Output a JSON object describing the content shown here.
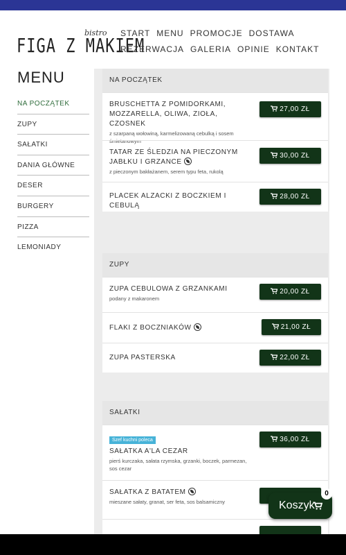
{
  "brand": {
    "name": "FIGA Z MAKIEM",
    "sub": "bistro"
  },
  "nav": [
    "START",
    "MENU",
    "PROMOCJE",
    "DOSTAWA",
    "REZERWACJA",
    "GALERIA",
    "OPINIE",
    "KONTAKT"
  ],
  "sidebar": {
    "title": "MENU",
    "items": [
      "NA POCZĄTEK",
      "ZUPY",
      "SAŁATKI",
      "DANIA GŁÓWNE",
      "DESER",
      "BURGERY",
      "PIZZA",
      "LEMONIADY"
    ]
  },
  "sections": [
    {
      "title": "NA POCZĄTEK",
      "items": [
        {
          "name": "BRUSCHETTA Z POMIDORKAMI, MOZZARELLA, OLIWA, ZIOŁA, CZOSNEK",
          "desc": "z szarpaną wołowiną, karmelizowaną cebulką i sosem śmietanowym",
          "price": "27,00 ZŁ"
        },
        {
          "name": "TATAR ZE ŚLEDZIA NA PIECZONYM JABŁKU I GRZANCE",
          "desc": "z pieczonym bakłażanem, serem typu feta, rukolą",
          "price": "30,00 ZŁ"
        },
        {
          "name": "PLACEK ALZACKI Z BOCZKIEM I CEBULĄ",
          "desc": "",
          "price": "28,00 ZŁ"
        }
      ]
    },
    {
      "title": "ZUPY",
      "items": [
        {
          "name": "ZUPA CEBULOWA Z GRZANKAMI",
          "desc": "podany z makaronem",
          "price": "20,00 ZŁ"
        },
        {
          "name": "FLAKI Z BOCZNIAKÓW",
          "desc": "",
          "price": "21,00 ZŁ"
        },
        {
          "name": "ZUPA PASTERSKA",
          "desc": "",
          "price": "22,00 ZŁ"
        }
      ]
    },
    {
      "title": "SAŁATKI",
      "items": [
        {
          "badge": "Szef kuchni poleca",
          "name": "SAŁATKA A'LA CEZAR",
          "desc": "pierś kurczaka, sałata rzymska, grzanki, boczek, parmezan, sos cezar",
          "price": "36,00 ZŁ"
        },
        {
          "name": "SAŁATKA Z BATATEM",
          "desc": "mieszane sałaty, granat, ser feta, sos balsamiczny",
          "price": ""
        }
      ]
    }
  ],
  "cart": {
    "label": "Koszyk",
    "count": "0"
  },
  "colors": {
    "primary": "#123418",
    "topbar": "#2b3595",
    "active": "#2e6b3a",
    "badge": "#47b3d8"
  },
  "icons": {
    "cart": "cart-icon",
    "vegetarian": "leaf-icon"
  }
}
